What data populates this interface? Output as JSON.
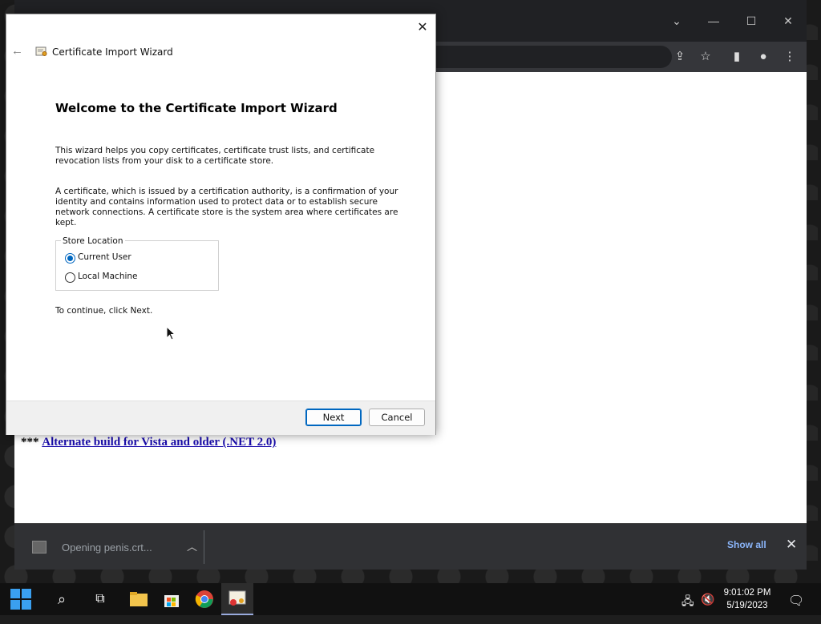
{
  "browser": {
    "alt_link_prefix": "***",
    "alt_link_text": "Alternate build for Vista and older (.NET 2.0)",
    "download_bar": {
      "file_text": "Opening penis.crt...",
      "show_all_label": "Show all"
    }
  },
  "dialog": {
    "title": "Certificate Import Wizard",
    "heading": "Welcome to the Certificate Import Wizard",
    "paragraph1": "This wizard helps you copy certificates, certificate trust lists, and certificate revocation lists from your disk to a certificate store.",
    "paragraph2": "A certificate, which is issued by a certification authority, is a confirmation of your identity and contains information used to protect data or to establish secure network connections. A certificate store is the system area where certificates are kept.",
    "store_location_label": "Store Location",
    "options": [
      {
        "label": "Current User",
        "checked": true
      },
      {
        "label": "Local Machine",
        "checked": false
      }
    ],
    "continue_text": "To continue, click Next.",
    "next_label": "Next",
    "cancel_label": "Cancel"
  },
  "taskbar": {
    "time": "9:01:02 PM",
    "date": "5/19/2023"
  },
  "colors": {
    "accent": "#0067c0",
    "link": "#1a0dab",
    "show_all": "#8ab4f8"
  }
}
